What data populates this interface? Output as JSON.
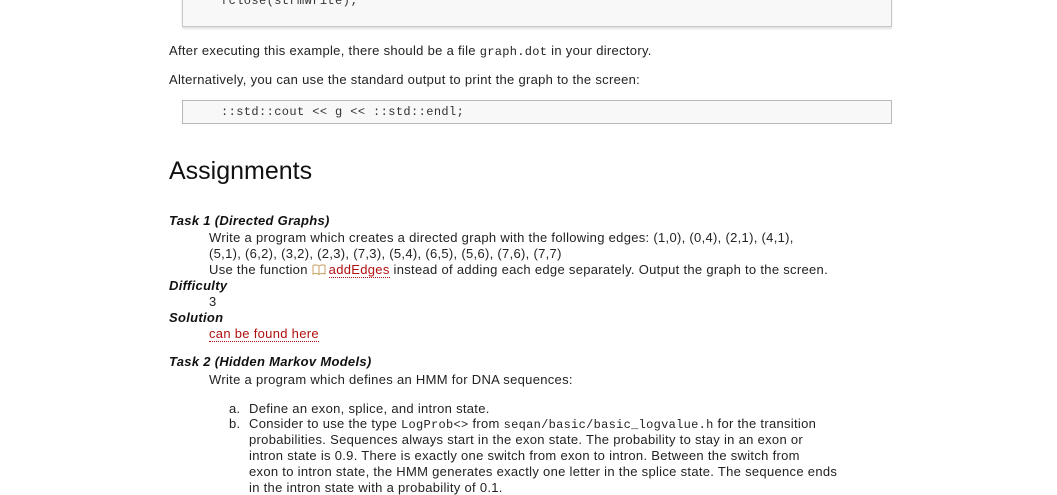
{
  "top_code": {
    "line": "fclose(strmWrite);"
  },
  "after_text": {
    "before": "After executing this example, there should be a file ",
    "filename": "graph.dot",
    "after": " in your directory."
  },
  "alt_text": "Alternatively, you can use the standard output to print the graph to the screen:",
  "code_snippet": "::std::cout << g << ::std::endl;",
  "assignments_heading": "Assignments",
  "task1": {
    "title": "Task 1 (Directed Graphs)",
    "line1": "Write a program which creates a directed graph with the following edges: (1,0), (0,4), (2,1), (4,1),",
    "line2": "(5,1), (6,2), (3,2), (2,3), (7,3), (5,4), (6,5), (5,6), (7,6), (7,7)",
    "use_before": "Use the function ",
    "use_link": "addEdges",
    "use_after": " instead of adding each edge separately. Output the graph to the screen.",
    "difficulty_label": "Difficulty",
    "difficulty_value": "3",
    "solution_label": "Solution",
    "solution_link": "can be found here"
  },
  "task2": {
    "title": "Task 2 (Hidden Markov Models)",
    "intro": "Write a program which defines an HMM for DNA sequences:",
    "items": [
      {
        "marker": "a.",
        "lines": [
          "Define an exon, splice, and intron state."
        ]
      },
      {
        "marker": "b.",
        "first_before": "Consider to use the type ",
        "first_type": "LogProb<>",
        "first_mid": " from ",
        "first_path": "seqan/basic/basic_logvalue.h",
        "first_after": " for the transition",
        "lines": [
          "probabilities. Sequences always start in the exon state. The probability to stay in an exon or",
          "intron state is 0.9. There is exactly one switch from exon to intron. Between the switch from",
          "exon to intron state, the HMM generates exactly one letter in the splice state. The sequence ends",
          "in the intron state with a probability of 0.1."
        ]
      }
    ]
  },
  "colors": {
    "link": "#b01010",
    "code_bg": "#f8f8f8",
    "code_border": "#b8b8b8"
  },
  "icons": {
    "doc_link": "book-icon"
  }
}
